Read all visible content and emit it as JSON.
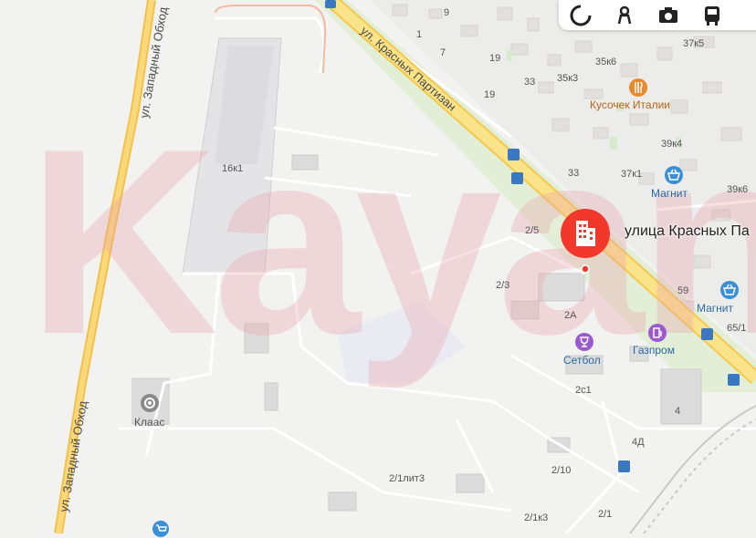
{
  "watermark": "Kayan",
  "roads": {
    "zapadny": "ул. Западный Обход",
    "partizan": "ул. Красных Партизан"
  },
  "selected_place": {
    "label": "улица Красных Па"
  },
  "pois": {
    "kusochek": "Кусочек Италии",
    "magnit1": "Магнит",
    "magnit2": "Магнит",
    "setbol": "Сетбол",
    "gazprom": "Газпром",
    "klaas": "Клаас"
  },
  "house_numbers": {
    "n9": "9",
    "n1": "1",
    "n7": "7",
    "n19a": "19",
    "n19b": "19",
    "n33a": "33",
    "n33b": "33",
    "n35k6": "35к6",
    "n35k3": "35к3",
    "n37k5": "37к5",
    "n39k4": "39к4",
    "n37k1": "37к1",
    "n39k6": "39к6",
    "n59": "59",
    "n65_1": "65/1",
    "n16k1": "16к1",
    "n2_5": "2/5",
    "n2_3": "2/3",
    "n2a": "2А",
    "n2c1": "2с1",
    "n4": "4",
    "n4d": "4Д",
    "n2_10": "2/10",
    "n2_1lit3": "2/1лит3",
    "n2_1k3": "2/1к3",
    "n2_1": "2/1"
  },
  "toolbar": {
    "buttons": [
      "traffic-icon",
      "panorama-icon",
      "camera-icon",
      "transit-icon"
    ]
  },
  "colors": {
    "marker": "#f1382b",
    "main_road": "#fbe38a",
    "secondary_road": "#f5c84b",
    "poi_blue": "#3b8fd6",
    "poi_orange": "#e8892b",
    "poi_purple": "#9a5ad0"
  }
}
